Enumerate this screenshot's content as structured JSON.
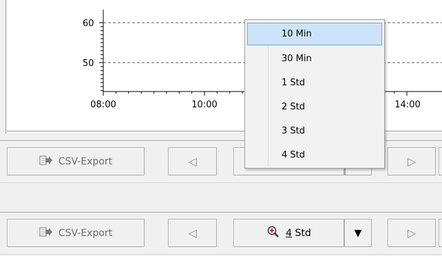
{
  "chart_data": {
    "type": "line",
    "series": [],
    "y_ticks": [
      "60",
      "50"
    ],
    "x_ticks": [
      "08:00",
      "10:00",
      "14:00"
    ],
    "grid": true
  },
  "toolbar_top": {
    "csv_label": "CSV-Export",
    "prev_glyph": "◁",
    "next_glyph": "▷"
  },
  "toolbar_bottom": {
    "csv_label": "CSV-Export",
    "prev_glyph": "◁",
    "zoom_label": "4 Std",
    "zoom_accel": "4",
    "zoom_rest": " Std",
    "drop_glyph": "▼",
    "next_glyph": "▷"
  },
  "menu": {
    "items": [
      {
        "label": "10 Min",
        "selected": true
      },
      {
        "label": "30 Min",
        "selected": false
      },
      {
        "label": "1 Std",
        "selected": false
      },
      {
        "label": "2 Std",
        "selected": false
      },
      {
        "label": "3 Std",
        "selected": false
      },
      {
        "label": "4 Std",
        "selected": false
      }
    ]
  },
  "icons": {
    "csv": "export-icon",
    "zoom": "zoom-icon",
    "prev": "left-arrow-icon",
    "next": "right-arrow-icon",
    "dropdown": "dropdown-arrow-icon"
  },
  "colors": {
    "menu_highlight": "#cce4f7",
    "menu_highlight_border": "#66a7e8",
    "zoom_plus": "#d00000"
  }
}
